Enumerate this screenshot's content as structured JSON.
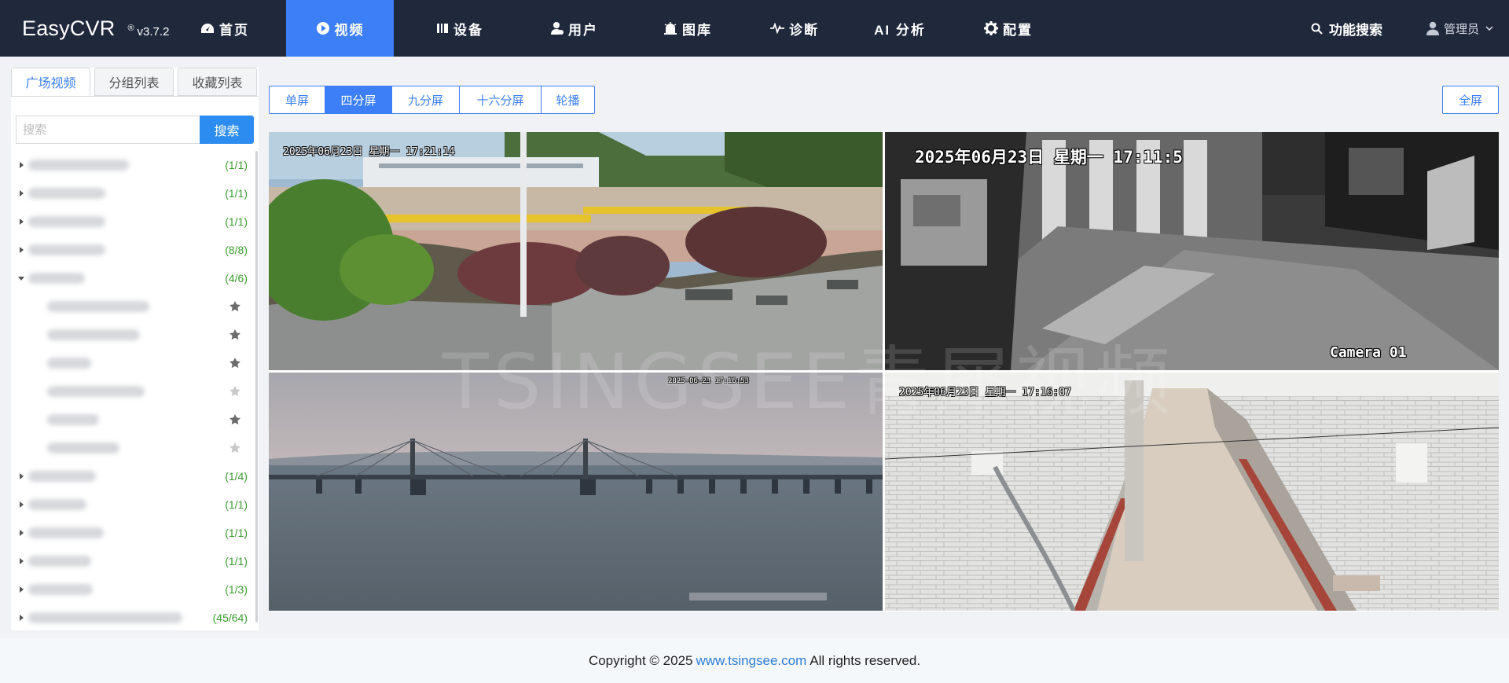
{
  "header": {
    "app_name": "EasyCVR",
    "version_mark": "®",
    "version": "v3.7.2",
    "nav": [
      {
        "label": "首页",
        "icon": "dashboard-icon",
        "active": false
      },
      {
        "label": "视频",
        "icon": "play-circle-icon",
        "active": true
      },
      {
        "label": "设备",
        "icon": "device-icon",
        "active": false
      },
      {
        "label": "用户",
        "icon": "user-icon",
        "active": false
      },
      {
        "label": "图库",
        "icon": "gallery-icon",
        "active": false
      },
      {
        "label": "诊断",
        "icon": "pulse-icon",
        "active": false
      },
      {
        "label": "AI 分析",
        "icon": "",
        "active": false
      },
      {
        "label": "配置",
        "icon": "gear-icon",
        "active": false
      }
    ],
    "feature_search": "功能搜索",
    "user": "管理员"
  },
  "sidebar": {
    "tabs": [
      {
        "label": "广场视频",
        "active": true
      },
      {
        "label": "分组列表",
        "active": false
      },
      {
        "label": "收藏列表",
        "active": false
      }
    ],
    "search_placeholder": "搜索",
    "search_button": "搜索",
    "tree": [
      {
        "type": "group",
        "expanded": false,
        "count": "(1/1)"
      },
      {
        "type": "group",
        "expanded": false,
        "count": "(1/1)"
      },
      {
        "type": "group",
        "expanded": false,
        "count": "(1/1)"
      },
      {
        "type": "group",
        "expanded": false,
        "count": "(8/8)"
      },
      {
        "type": "group",
        "expanded": true,
        "count": "(4/6)"
      },
      {
        "type": "channel",
        "online": true
      },
      {
        "type": "channel",
        "online": true
      },
      {
        "type": "channel",
        "online": true
      },
      {
        "type": "channel",
        "online": false
      },
      {
        "type": "channel",
        "online": true
      },
      {
        "type": "channel",
        "online": false
      },
      {
        "type": "group",
        "expanded": false,
        "count": "(1/4)"
      },
      {
        "type": "group",
        "expanded": false,
        "count": "(1/1)"
      },
      {
        "type": "group",
        "expanded": false,
        "count": "(1/1)"
      },
      {
        "type": "group",
        "expanded": false,
        "count": "(1/1)"
      },
      {
        "type": "group",
        "expanded": false,
        "count": "(1/3)"
      },
      {
        "type": "group",
        "expanded": false,
        "count": "(45/64)"
      }
    ]
  },
  "toolbar": {
    "layouts": [
      {
        "label": "单屏",
        "active": false
      },
      {
        "label": "四分屏",
        "active": true
      },
      {
        "label": "九分屏",
        "active": false
      },
      {
        "label": "十六分屏",
        "active": false
      },
      {
        "label": "轮播",
        "active": false
      }
    ],
    "fullscreen": "全屏"
  },
  "cameras": [
    {
      "osd": "2025年06月23日 星期一 17:21:14"
    },
    {
      "osd": "2025年06月23日 星期一 17:11:5",
      "label": "Camera 01"
    },
    {
      "osd": "2025-06-23 17:16:53"
    },
    {
      "osd": "2025年06月23日 星期一 17:16:07"
    }
  ],
  "watermark": "TSINGSEE青犀视频",
  "footer": {
    "prefix": "Copyright © 2025",
    "link": "www.tsingsee.com",
    "suffix": "All rights reserved."
  },
  "colors": {
    "header_bg": "#20293c",
    "accent": "#3d7ff7",
    "count_green": "#3a9b2f"
  }
}
